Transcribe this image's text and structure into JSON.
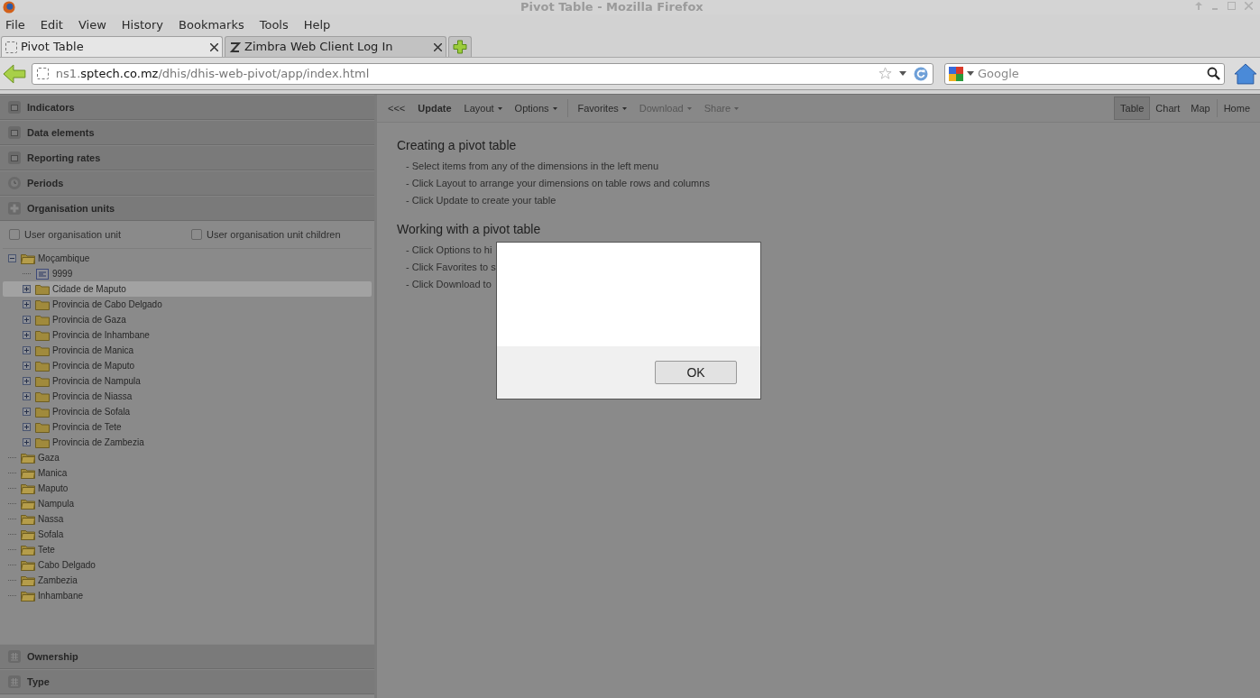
{
  "window": {
    "title": "Pivot Table - Mozilla Firefox"
  },
  "menu": [
    "File",
    "Edit",
    "View",
    "History",
    "Bookmarks",
    "Tools",
    "Help"
  ],
  "tabs": [
    {
      "label": "Pivot Table",
      "selected": true
    },
    {
      "label": "Zimbra Web Client Log In",
      "selected": false
    }
  ],
  "address": {
    "host_prefix": "ns1.",
    "domain": "sptech.co.mz",
    "path": "/dhis/dhis-web-pivot/app/index.html"
  },
  "search": {
    "placeholder": "Google"
  },
  "sections_top": [
    {
      "label": "Indicators",
      "kind": "data"
    },
    {
      "label": "Data elements",
      "kind": "data"
    },
    {
      "label": "Reporting rates",
      "kind": "data"
    },
    {
      "label": "Periods",
      "kind": "period"
    },
    {
      "label": "Organisation units",
      "kind": "orgunit"
    }
  ],
  "org_options": [
    {
      "label": "User organisation unit",
      "checked": false
    },
    {
      "label": "User organisation unit children",
      "checked": false
    }
  ],
  "tree": [
    {
      "name": "Moçambique",
      "kind": "branch",
      "expanded": true,
      "selected": false,
      "children": [
        {
          "name": "9999",
          "kind": "record",
          "selected": false
        },
        {
          "name": "Cidade de Maputo",
          "kind": "branch",
          "expanded": false,
          "selected": true
        },
        {
          "name": "Provincia de Cabo Delgado",
          "kind": "branch",
          "expanded": false,
          "selected": false
        },
        {
          "name": "Provincia de Gaza",
          "kind": "branch",
          "expanded": false,
          "selected": false
        },
        {
          "name": "Provincia de Inhambane",
          "kind": "branch",
          "expanded": false,
          "selected": false
        },
        {
          "name": "Provincia de Manica",
          "kind": "branch",
          "expanded": false,
          "selected": false
        },
        {
          "name": "Provincia de Maputo",
          "kind": "branch",
          "expanded": false,
          "selected": false
        },
        {
          "name": "Provincia de Nampula",
          "kind": "branch",
          "expanded": false,
          "selected": false
        },
        {
          "name": "Provincia de Niassa",
          "kind": "branch",
          "expanded": false,
          "selected": false
        },
        {
          "name": "Provincia de Sofala",
          "kind": "branch",
          "expanded": false,
          "selected": false
        },
        {
          "name": "Provincia de Tete",
          "kind": "branch",
          "expanded": false,
          "selected": false
        },
        {
          "name": "Provincia de Zambezia",
          "kind": "branch",
          "expanded": false,
          "selected": false
        }
      ]
    },
    {
      "name": "Gaza",
      "kind": "folder",
      "selected": false
    },
    {
      "name": "Manica",
      "kind": "folder",
      "selected": false
    },
    {
      "name": "Maputo",
      "kind": "folder",
      "selected": false
    },
    {
      "name": "Nampula",
      "kind": "folder",
      "selected": false
    },
    {
      "name": "Nassa",
      "kind": "folder",
      "selected": false
    },
    {
      "name": "Sofala",
      "kind": "folder",
      "selected": false
    },
    {
      "name": "Tete",
      "kind": "folder",
      "selected": false
    },
    {
      "name": "Cabo Delgado",
      "kind": "folder",
      "selected": false
    },
    {
      "name": "Zambezia",
      "kind": "folder",
      "selected": false
    },
    {
      "name": "Inhambane",
      "kind": "folder",
      "selected": false
    }
  ],
  "sections_bottom": [
    {
      "label": "Ownership",
      "kind": "group"
    },
    {
      "label": "Type",
      "kind": "group"
    }
  ],
  "toolbar_groups": [
    {
      "buttons": [
        {
          "label": "<<<",
          "kind": "plain",
          "disabled": false
        },
        {
          "label": "Update",
          "kind": "primary",
          "disabled": false
        },
        {
          "label": "Layout",
          "kind": "menu",
          "disabled": false
        },
        {
          "label": "Options",
          "kind": "menu",
          "disabled": false
        }
      ]
    },
    {
      "buttons": [
        {
          "label": "Favorites",
          "kind": "menu",
          "disabled": false
        },
        {
          "label": "Download",
          "kind": "menu",
          "disabled": true
        },
        {
          "label": "Share",
          "kind": "menu",
          "disabled": true
        }
      ]
    }
  ],
  "view_tabs": [
    {
      "label": "Table",
      "selected": true
    },
    {
      "label": "Chart",
      "selected": false
    },
    {
      "label": "Map",
      "selected": false
    }
  ],
  "home_button": "Home",
  "help": [
    {
      "heading": "Creating a pivot table",
      "lines": [
        "- Select items from any of the dimensions in the left menu",
        "- Click Layout to arrange your dimensions on table rows and columns",
        "- Click Update to create your table"
      ]
    },
    {
      "heading": "Working with a pivot table",
      "lines": [
        "- Click Options to hi",
        "- Click Favorites to s",
        "- Click Download to"
      ]
    }
  ],
  "dialog": {
    "button": "OK"
  }
}
